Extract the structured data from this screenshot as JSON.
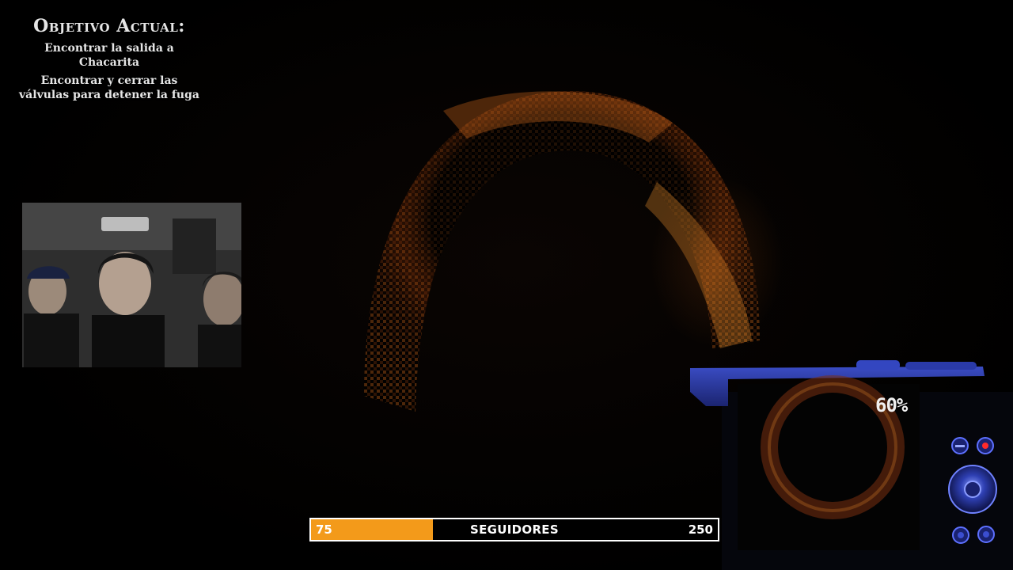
{
  "objective": {
    "title": "Objetivo Actual:",
    "items": [
      "Encontrar la salida a Chacarita",
      "Encontrar y cerrar las válvulas para detener la fuga"
    ]
  },
  "device": {
    "zoom_percent": "60%",
    "accent_color": "#2a3cb8"
  },
  "followers": {
    "label": "SEGUIDORES",
    "current": "75",
    "goal": "250",
    "progress": 0.3,
    "fill_color": "#f39a1a"
  },
  "icons": {
    "webcam": "webcam-feed",
    "device": "camera-device",
    "buttons": [
      "minus-button-icon",
      "record-button-icon",
      "dial-icon",
      "button-icon",
      "button-icon"
    ]
  }
}
